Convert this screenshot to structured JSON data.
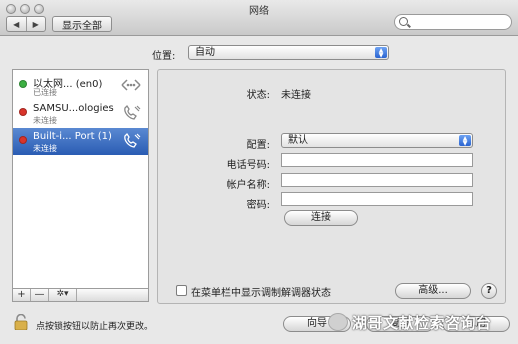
{
  "window": {
    "title": "网络"
  },
  "toolbar": {
    "back": "◀",
    "forward": "▶",
    "show_all": "显示全部",
    "search_placeholder": ""
  },
  "location": {
    "label": "位置:",
    "value": "自动"
  },
  "services": [
    {
      "name": "以太网... (en0)",
      "status": "已连接",
      "dot_color": "#3cb043",
      "icon": "ethernet-icon"
    },
    {
      "name": "SAMSU...ologies",
      "status": "未连接",
      "dot_color": "#d9342b",
      "icon": "phone-icon"
    },
    {
      "name": "Built-i... Port (1)",
      "status": "未连接",
      "dot_color": "#d9342b",
      "icon": "phone-icon",
      "selected": true
    }
  ],
  "sidebar_toolbar": {
    "add": "+",
    "remove": "—",
    "gear": "✲▾"
  },
  "detail": {
    "status_label": "状态:",
    "status_value": "未连接",
    "config_label": "配置:",
    "config_value": "默认",
    "phone_label": "电话号码:",
    "phone_value": "",
    "account_label": "帐户名称:",
    "account_value": "",
    "password_label": "密码:",
    "password_value": "",
    "connect_button": "连接",
    "show_status_label": "在菜单栏中显示调制解调器状态",
    "advanced_button": "高级...",
    "help_button": "?"
  },
  "bottom": {
    "lock_text": "点按锁按钮以防止再次更改。",
    "assist_button": "向导",
    "revert_button": "复原",
    "apply_button": "应用"
  },
  "watermark": {
    "text": "湖哥文献检索咨询台"
  },
  "colors": {
    "selection": "#3a6cc4",
    "accent": "#2a64d0"
  }
}
